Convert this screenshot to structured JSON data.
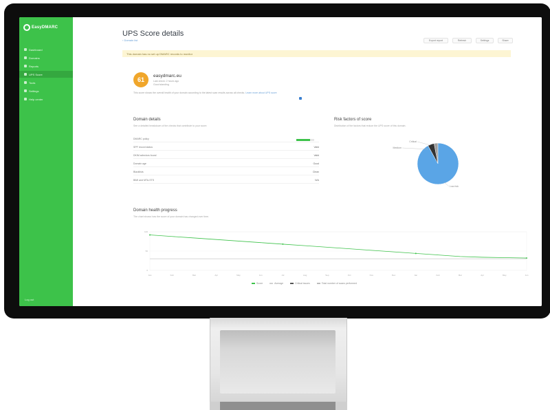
{
  "app": {
    "logo_text": "EasyDMARC",
    "page_title": "UPS Score details",
    "breadcrumb": "‹ Domain list",
    "header_buttons": [
      "Export report",
      "Refresh",
      "Settings",
      "Share"
    ]
  },
  "sidebar": {
    "items": [
      {
        "label": "Dashboard",
        "icon": "dashboard-icon",
        "active": false
      },
      {
        "label": "Domains",
        "icon": "globe-icon",
        "active": false
      },
      {
        "label": "Reports",
        "icon": "report-icon",
        "active": false
      },
      {
        "label": "UPS Score",
        "icon": "shield-icon",
        "active": true
      },
      {
        "label": "Tools",
        "icon": "wrench-icon",
        "active": false
      },
      {
        "label": "Settings",
        "icon": "gear-icon",
        "active": false
      },
      {
        "label": "Help center",
        "icon": "help-icon",
        "active": false
      }
    ],
    "footer": "Log out"
  },
  "alert": {
    "text": "This domain has no set up DMARC records to monitor"
  },
  "domain": {
    "score": "61",
    "name": "easydmarc.eu",
    "sub1": "Last check: 2 hours ago",
    "sub2": "Good standing"
  },
  "description": {
    "text": "This score shows the overall health of your domain according to the latest scan results across all checks.",
    "link": "Learn more about UPS score"
  },
  "details": {
    "title": "Domain details",
    "desc": "See a detailed breakdown of the checks that contribute to your score.",
    "rows": [
      {
        "label": "DMARC policy",
        "value": ""
      },
      {
        "label": "SPF record status",
        "value": "Valid"
      },
      {
        "label": "DKIM selectors found",
        "value": "Valid"
      },
      {
        "label": "Domain age",
        "value": "Good"
      },
      {
        "label": "Blacklists",
        "value": "Clean"
      },
      {
        "label": "BIMI and MTA-STS",
        "value": "N/A"
      }
    ],
    "policy_fraction": 0.75
  },
  "risk": {
    "title": "Risk factors of score",
    "desc": "Distribution of the factors that reduce the UPS score of this domain.",
    "slices": [
      {
        "label": "Low risk",
        "value": 92,
        "color": "#5aa5e6"
      },
      {
        "label": "Critical",
        "value": 5,
        "color": "#333333"
      },
      {
        "label": "Medium",
        "value": 3,
        "color": "#9e9e9e"
      }
    ]
  },
  "history": {
    "title": "Domain health progress",
    "desc": "The chart shows how the score of your domain has changed over time.",
    "chart_data": {
      "type": "line",
      "x": [
        "Jan",
        "Feb",
        "Mar",
        "Apr",
        "May",
        "Jun",
        "Jul",
        "Aug",
        "Sep",
        "Oct",
        "Nov",
        "Dec",
        "Jan",
        "Feb",
        "Mar",
        "Apr",
        "May",
        "Jun"
      ],
      "series": [
        {
          "name": "Score",
          "color": "#3dc24a",
          "values": [
            92,
            88,
            84,
            80,
            76,
            72,
            68,
            64,
            60,
            56,
            52,
            48,
            44,
            40,
            36,
            34,
            33,
            32
          ]
        },
        {
          "name": "Average",
          "color": "#d0d0d0",
          "values": [
            30,
            30,
            30,
            30,
            30,
            30,
            30,
            30,
            30,
            30,
            30,
            30,
            30,
            30,
            30,
            30,
            30,
            30
          ]
        }
      ],
      "ylim": [
        0,
        100
      ],
      "legend": [
        "Score",
        "Average",
        "Critical issues",
        "Total number of scans performed"
      ]
    }
  }
}
